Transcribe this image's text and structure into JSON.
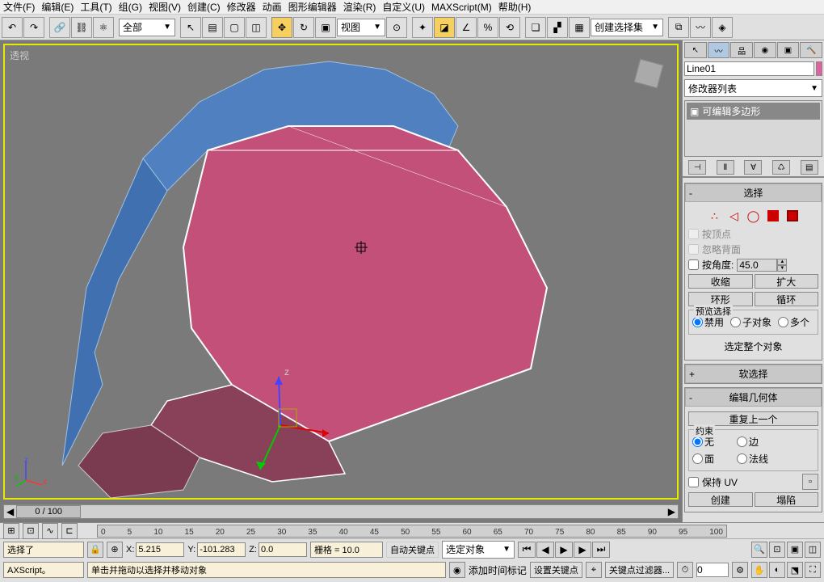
{
  "menu": {
    "file": "文件(F)",
    "edit": "编辑(E)",
    "tools": "工具(T)",
    "group": "组(G)",
    "views": "视图(V)",
    "create": "创建(C)",
    "modifiers": "修改器",
    "animation": "动画",
    "grapheditors": "图形编辑器",
    "rendering": "渲染(R)",
    "customize": "自定义(U)",
    "maxscript": "MAXScript(M)",
    "help": "帮助(H)"
  },
  "toolbar": {
    "all": "全部",
    "view": "视图",
    "selset": "创建选择集"
  },
  "viewport": {
    "label": "透视"
  },
  "timeline": {
    "slider": "0 / 100"
  },
  "ruler": {
    "ticks": [
      "0",
      "5",
      "10",
      "15",
      "20",
      "25",
      "30",
      "35",
      "40",
      "45",
      "50",
      "55",
      "60",
      "65",
      "70",
      "75",
      "80",
      "85",
      "90",
      "95",
      "100"
    ]
  },
  "sidebar": {
    "object_name": "Line01",
    "mod_list": "修改器列表",
    "mod_item": "可编辑多边形",
    "rollups": {
      "selection": "选择",
      "soft_sel": "软选择",
      "edit_geom": "编辑几何体"
    },
    "sel": {
      "by_vertex": "按顶点",
      "ignore_back": "忽略背面",
      "by_angle": "按角度:",
      "angle_val": "45.0",
      "shrink": "收缩",
      "grow": "扩大",
      "ring": "环形",
      "loop": "循环",
      "preview_sel": "预览选择",
      "radio_off": "禁用",
      "radio_sub": "子对象",
      "radio_multi": "多个",
      "sel_whole": "选定整个对象"
    },
    "geom": {
      "repeat_last": "重复上一个",
      "constraints": "约束",
      "none": "无",
      "edge": "边",
      "face": "面",
      "normal": "法线",
      "preserve_uv": "保持 UV",
      "create_btn": "创建",
      "collapse_btn": "塌陷"
    }
  },
  "status": {
    "script": "AXScript。",
    "selected": "选择了",
    "x": "5.215",
    "y": "-101.283",
    "z": "0.0",
    "grid": "栅格 = 10.0",
    "hint": "单击并拖动以选择并移动对象",
    "auto_key": "自动关键点",
    "set_key": "设置关键点",
    "sel_obj": "选定对象",
    "key_filter": "关键点过滤器...",
    "add_time": "添加时间标记"
  }
}
